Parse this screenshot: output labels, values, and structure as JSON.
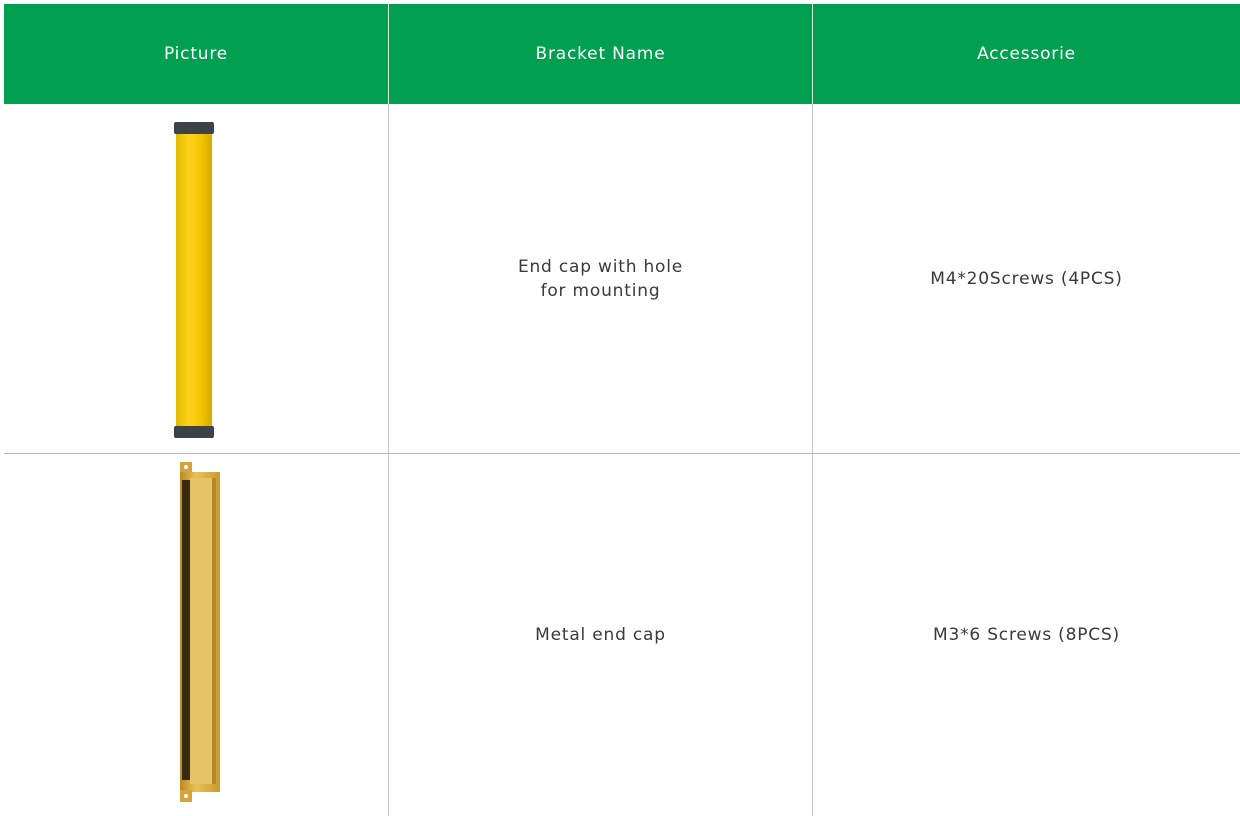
{
  "columns": [
    "Picture",
    "Bracket Name",
    "Accessorie"
  ],
  "rows": [
    {
      "picture": "yellow-plastic-end-cap-bar",
      "bracket_name": "End cap with hole\nfor mounting",
      "accessory": "M4*20Screws (4PCS)"
    },
    {
      "picture": "gold-metal-end-cap-bar",
      "bracket_name": "Metal end cap",
      "accessory": "M3*6 Screws (8PCS)"
    }
  ],
  "colors": {
    "header_bg": "#00a050",
    "header_text": "#ffffff",
    "body_text": "#3a3a3a",
    "grid": "#c8c8c8"
  }
}
